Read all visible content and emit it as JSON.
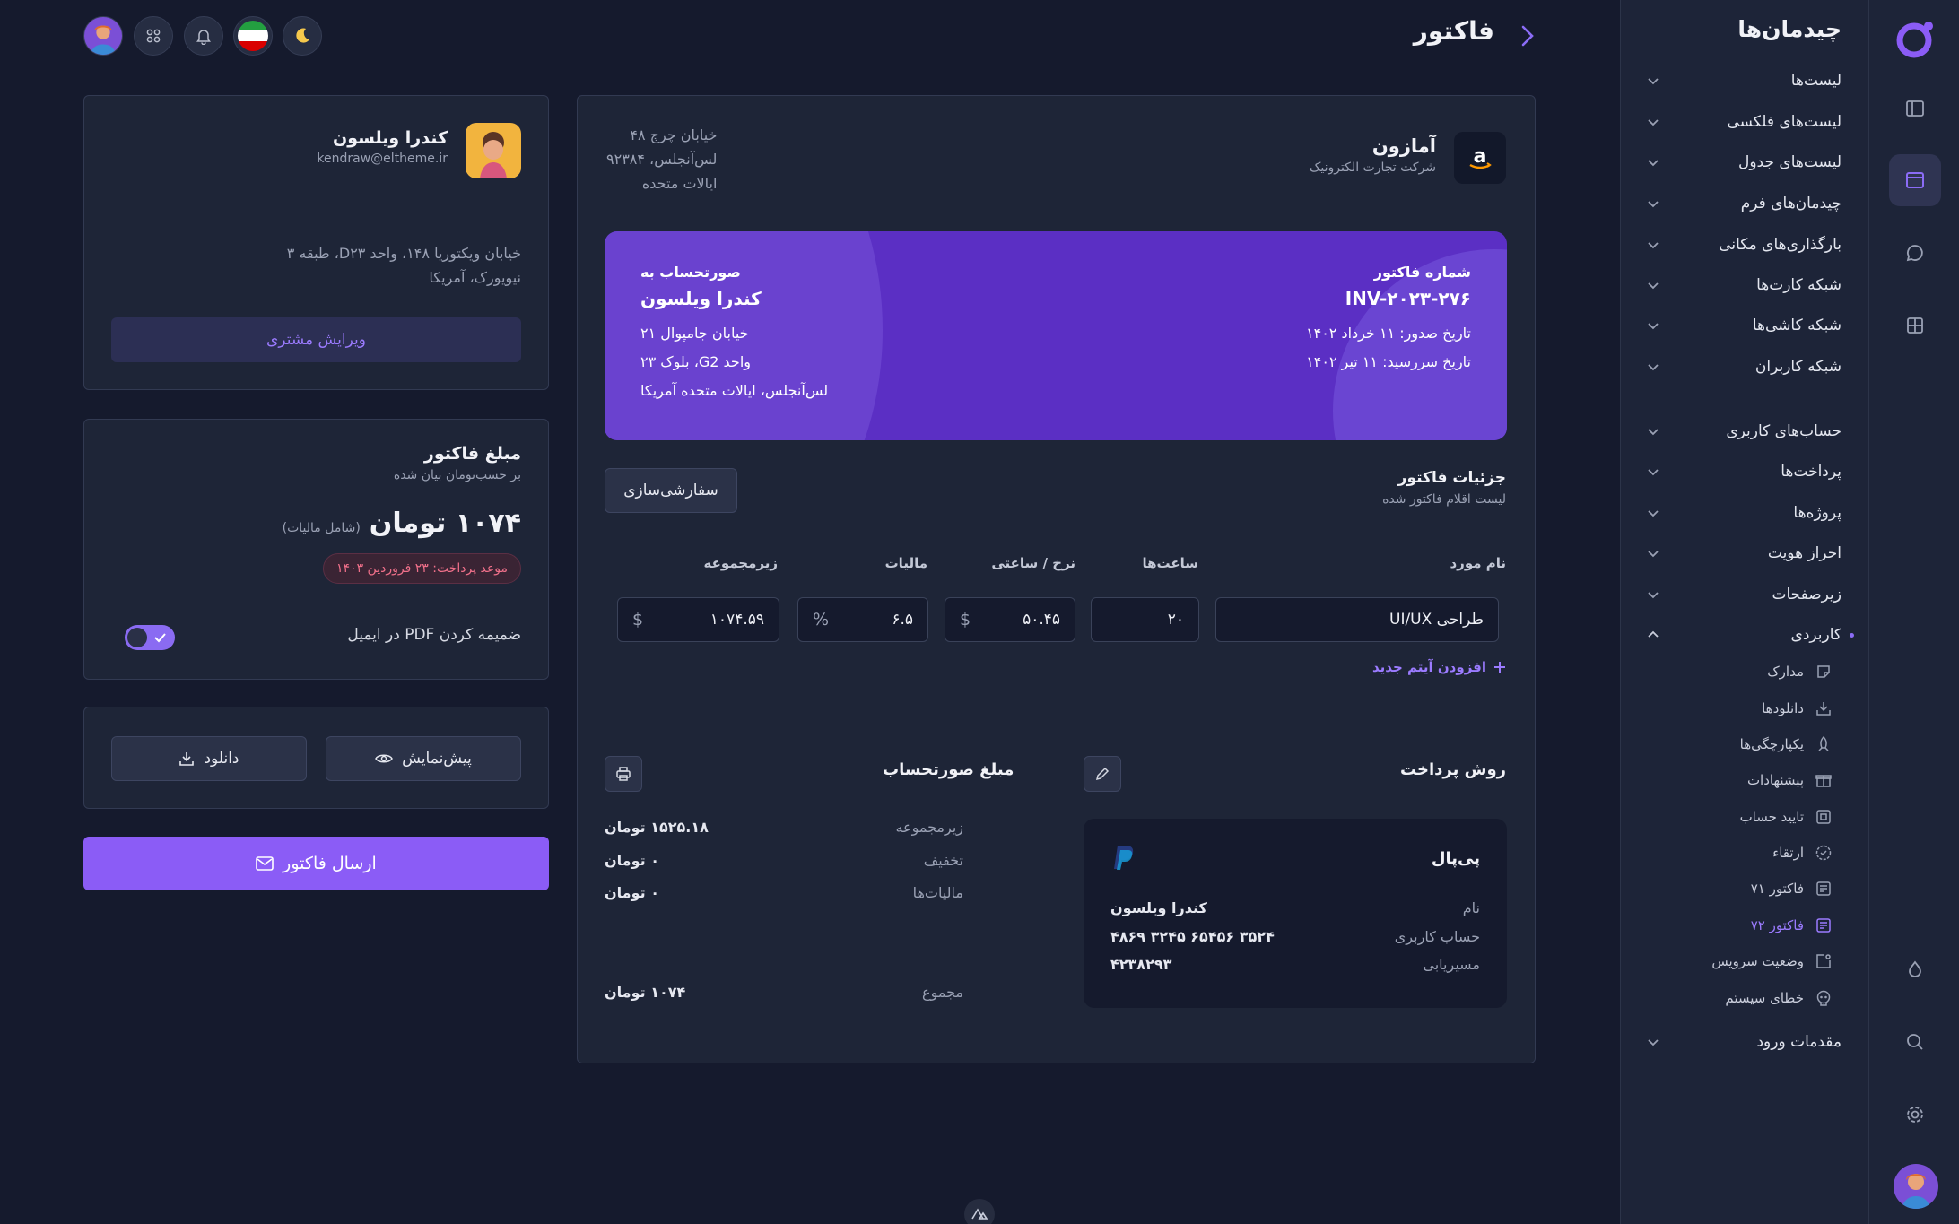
{
  "header": {
    "title": "فاکتور"
  },
  "sidebar": {
    "title": "چیدمان‌ها",
    "items": [
      {
        "label": "لیست‌ها"
      },
      {
        "label": "لیست‌های فلکسی"
      },
      {
        "label": "لیست‌های جدول"
      },
      {
        "label": "چیدمان‌های فرم"
      },
      {
        "label": "بارگذاری‌های مکانی"
      },
      {
        "label": "شبکه کارت‌ها"
      },
      {
        "label": "شبکه کاشی‌ها"
      },
      {
        "label": "شبکه کاربران"
      }
    ],
    "items2": [
      {
        "label": "حساب‌های کاربری"
      },
      {
        "label": "پرداخت‌ها"
      },
      {
        "label": "پروژه‌ها"
      },
      {
        "label": "احراز هویت"
      },
      {
        "label": "زیرصفحات"
      },
      {
        "label": "کاربردی"
      }
    ],
    "sub": [
      {
        "label": "مدارک",
        "icon": "sticker-icon"
      },
      {
        "label": "دانلودها",
        "icon": "download-tray-icon"
      },
      {
        "label": "یکپارچگی‌ها",
        "icon": "rocket-icon"
      },
      {
        "label": "پیشنهادات",
        "icon": "gift-icon"
      },
      {
        "label": "تایید حساب",
        "icon": "verify-box-icon"
      },
      {
        "label": "ارتقاء",
        "icon": "badge-check-icon"
      },
      {
        "label": "فاکتور ۷۱",
        "icon": "invoice-icon"
      },
      {
        "label": "فاکتور ۷۲",
        "icon": "invoice-icon"
      },
      {
        "label": "وضعیت سرویس",
        "icon": "status-icon"
      },
      {
        "label": "خطای سیستم",
        "icon": "skull-icon"
      }
    ],
    "last": {
      "label": "مقدمات ورود"
    }
  },
  "invoice": {
    "company_name": "آمازون",
    "company_desc": "شرکت تجارت الکترونیک",
    "address_line1": "خیابان چرچ ۴۸",
    "address_line2": "لس‌آنجلس، ۹۲۳۸۴",
    "address_line3": "ایالات متحده",
    "banner": {
      "number_label": "شماره فاکتور",
      "number": "INV-۲۰۲۳-۲۷۶",
      "issue_date": "تاریخ صدور: ۱۱ خرداد ۱۴۰۲",
      "due_date": "تاریخ سررسید: ۱۱ تیر ۱۴۰۲",
      "bill_to_label": "صورتحساب به",
      "bill_to_name": "کندرا ویلسون",
      "bill_line1": "خیابان جامپوال ۲۱",
      "bill_line2": "واحد G2، بلوک ۲۳",
      "bill_line3": "لس‌آنجلس، ایالات متحده آمریکا"
    },
    "details_title": "جزئیات فاکتور",
    "details_subtitle": "لیست اقلام فاکتور شده",
    "customize_label": "سفارشی‌سازی",
    "columns": {
      "item": "نام مورد",
      "hours": "ساعت‌ها",
      "rate": "نرخ / ساعتی",
      "tax": "مالیات",
      "subtotal": "زیرمجموعه"
    },
    "row": {
      "item": "طراحی UI/UX",
      "hours": "۲۰",
      "rate": "۵۰.۴۵",
      "rate_unit": "$",
      "tax": "۶.۵",
      "tax_unit": "%",
      "subtotal": "۱۰۷۴.۵۹",
      "subtotal_unit": "$"
    },
    "add_item_label": "افزودن آیتم جدید",
    "payment": {
      "title": "روش پرداخت",
      "provider": "پی‌پال",
      "name_label": "نام",
      "name_value": "کندرا ویلسون",
      "account_label": "حساب کاربری",
      "account_value": "۳۵۲۴ ۶۵۴۵۶ ۳۲۴۵ ۴۸۶۹",
      "routing_label": "مسیریابی",
      "routing_value": "۴۲۳۸۲۹۳"
    },
    "summary": {
      "title": "مبلغ صورتحساب",
      "subtotal_label": "زیرمجموعه",
      "subtotal_value": "۱۵۲۵.۱۸ تومان",
      "discount_label": "تخفیف",
      "discount_value": "۰ تومان",
      "tax_label": "مالیات‌ها",
      "tax_value": "۰ تومان",
      "total_label": "مجموع",
      "total_value": "۱۰۷۴ تومان"
    }
  },
  "customer": {
    "name": "کندرا ویلسون",
    "email": "kendraw@eltheme.ir",
    "address_line1": "خیابان ویکتوریا ۱۴۸، واحد D۲۳، طبقه ۳",
    "address_line2": "نیویورک، آمریکا",
    "edit_label": "ویرایش مشتری"
  },
  "amount": {
    "title": "مبلغ فاکتور",
    "subtitle": "بر حسب‌تومان بیان شده",
    "value": "۱۰۷۴ تومان",
    "tax_note": "(شامل مالیات)",
    "due_badge": "موعد پرداخت: ۲۳ فروردین ۱۴۰۳",
    "attach_pdf_label": "ضمیمه کردن PDF در ایمیل",
    "attach_pdf_on": true
  },
  "actions": {
    "preview_label": "پیش‌نمایش",
    "download_label": "دانلود",
    "send_label": "ارسال فاکتور"
  },
  "colors": {
    "background": "#151a2d",
    "card": "#1e2537",
    "accent": "#8b5cf6",
    "banner": "#6d3fd6",
    "badge_text": "#f0708a"
  }
}
